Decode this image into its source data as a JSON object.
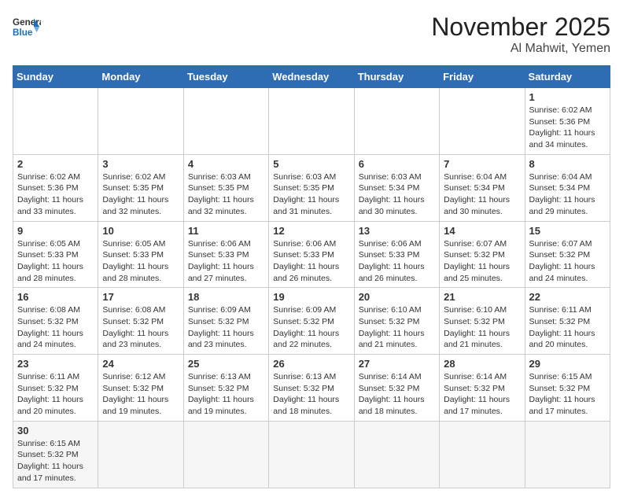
{
  "header": {
    "logo_general": "General",
    "logo_blue": "Blue",
    "month_title": "November 2025",
    "location": "Al Mahwit, Yemen"
  },
  "days_of_week": [
    "Sunday",
    "Monday",
    "Tuesday",
    "Wednesday",
    "Thursday",
    "Friday",
    "Saturday"
  ],
  "weeks": [
    [
      {
        "day": "",
        "info": ""
      },
      {
        "day": "",
        "info": ""
      },
      {
        "day": "",
        "info": ""
      },
      {
        "day": "",
        "info": ""
      },
      {
        "day": "",
        "info": ""
      },
      {
        "day": "",
        "info": ""
      },
      {
        "day": "1",
        "info": "Sunrise: 6:02 AM\nSunset: 5:36 PM\nDaylight: 11 hours\nand 34 minutes."
      }
    ],
    [
      {
        "day": "2",
        "info": "Sunrise: 6:02 AM\nSunset: 5:36 PM\nDaylight: 11 hours\nand 33 minutes."
      },
      {
        "day": "3",
        "info": "Sunrise: 6:02 AM\nSunset: 5:35 PM\nDaylight: 11 hours\nand 32 minutes."
      },
      {
        "day": "4",
        "info": "Sunrise: 6:03 AM\nSunset: 5:35 PM\nDaylight: 11 hours\nand 32 minutes."
      },
      {
        "day": "5",
        "info": "Sunrise: 6:03 AM\nSunset: 5:35 PM\nDaylight: 11 hours\nand 31 minutes."
      },
      {
        "day": "6",
        "info": "Sunrise: 6:03 AM\nSunset: 5:34 PM\nDaylight: 11 hours\nand 30 minutes."
      },
      {
        "day": "7",
        "info": "Sunrise: 6:04 AM\nSunset: 5:34 PM\nDaylight: 11 hours\nand 30 minutes."
      },
      {
        "day": "8",
        "info": "Sunrise: 6:04 AM\nSunset: 5:34 PM\nDaylight: 11 hours\nand 29 minutes."
      }
    ],
    [
      {
        "day": "9",
        "info": "Sunrise: 6:05 AM\nSunset: 5:33 PM\nDaylight: 11 hours\nand 28 minutes."
      },
      {
        "day": "10",
        "info": "Sunrise: 6:05 AM\nSunset: 5:33 PM\nDaylight: 11 hours\nand 28 minutes."
      },
      {
        "day": "11",
        "info": "Sunrise: 6:06 AM\nSunset: 5:33 PM\nDaylight: 11 hours\nand 27 minutes."
      },
      {
        "day": "12",
        "info": "Sunrise: 6:06 AM\nSunset: 5:33 PM\nDaylight: 11 hours\nand 26 minutes."
      },
      {
        "day": "13",
        "info": "Sunrise: 6:06 AM\nSunset: 5:33 PM\nDaylight: 11 hours\nand 26 minutes."
      },
      {
        "day": "14",
        "info": "Sunrise: 6:07 AM\nSunset: 5:32 PM\nDaylight: 11 hours\nand 25 minutes."
      },
      {
        "day": "15",
        "info": "Sunrise: 6:07 AM\nSunset: 5:32 PM\nDaylight: 11 hours\nand 24 minutes."
      }
    ],
    [
      {
        "day": "16",
        "info": "Sunrise: 6:08 AM\nSunset: 5:32 PM\nDaylight: 11 hours\nand 24 minutes."
      },
      {
        "day": "17",
        "info": "Sunrise: 6:08 AM\nSunset: 5:32 PM\nDaylight: 11 hours\nand 23 minutes."
      },
      {
        "day": "18",
        "info": "Sunrise: 6:09 AM\nSunset: 5:32 PM\nDaylight: 11 hours\nand 23 minutes."
      },
      {
        "day": "19",
        "info": "Sunrise: 6:09 AM\nSunset: 5:32 PM\nDaylight: 11 hours\nand 22 minutes."
      },
      {
        "day": "20",
        "info": "Sunrise: 6:10 AM\nSunset: 5:32 PM\nDaylight: 11 hours\nand 21 minutes."
      },
      {
        "day": "21",
        "info": "Sunrise: 6:10 AM\nSunset: 5:32 PM\nDaylight: 11 hours\nand 21 minutes."
      },
      {
        "day": "22",
        "info": "Sunrise: 6:11 AM\nSunset: 5:32 PM\nDaylight: 11 hours\nand 20 minutes."
      }
    ],
    [
      {
        "day": "23",
        "info": "Sunrise: 6:11 AM\nSunset: 5:32 PM\nDaylight: 11 hours\nand 20 minutes."
      },
      {
        "day": "24",
        "info": "Sunrise: 6:12 AM\nSunset: 5:32 PM\nDaylight: 11 hours\nand 19 minutes."
      },
      {
        "day": "25",
        "info": "Sunrise: 6:13 AM\nSunset: 5:32 PM\nDaylight: 11 hours\nand 19 minutes."
      },
      {
        "day": "26",
        "info": "Sunrise: 6:13 AM\nSunset: 5:32 PM\nDaylight: 11 hours\nand 18 minutes."
      },
      {
        "day": "27",
        "info": "Sunrise: 6:14 AM\nSunset: 5:32 PM\nDaylight: 11 hours\nand 18 minutes."
      },
      {
        "day": "28",
        "info": "Sunrise: 6:14 AM\nSunset: 5:32 PM\nDaylight: 11 hours\nand 17 minutes."
      },
      {
        "day": "29",
        "info": "Sunrise: 6:15 AM\nSunset: 5:32 PM\nDaylight: 11 hours\nand 17 minutes."
      }
    ],
    [
      {
        "day": "30",
        "info": "Sunrise: 6:15 AM\nSunset: 5:32 PM\nDaylight: 11 hours\nand 17 minutes."
      },
      {
        "day": "",
        "info": ""
      },
      {
        "day": "",
        "info": ""
      },
      {
        "day": "",
        "info": ""
      },
      {
        "day": "",
        "info": ""
      },
      {
        "day": "",
        "info": ""
      },
      {
        "day": "",
        "info": ""
      }
    ]
  ]
}
